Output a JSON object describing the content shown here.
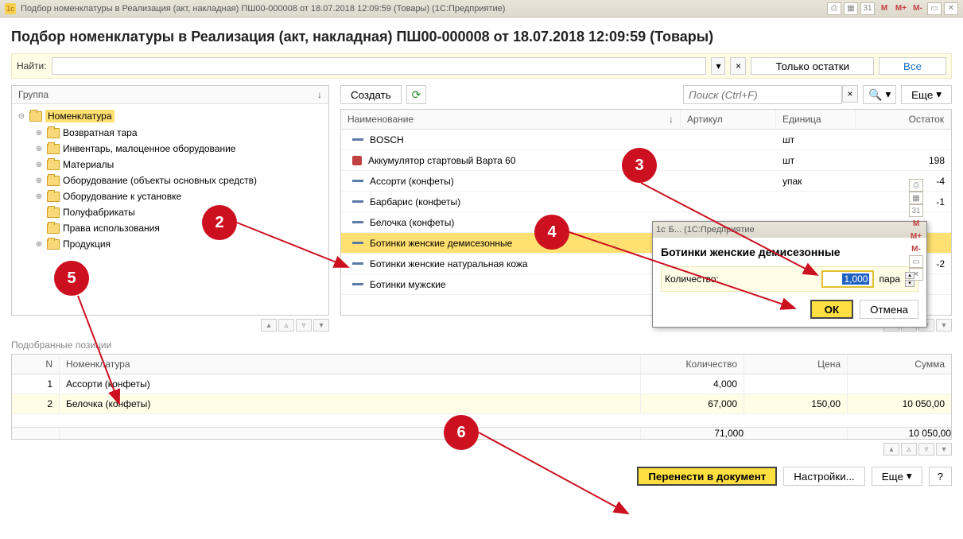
{
  "titlebar": {
    "title": "Подбор номенклатуры в Реализация (акт, накладная) ПШ00-000008 от 18.07.2018 12:09:59 (Товары)   (1С:Предприятие)"
  },
  "page_title": "Подбор номенклатуры в Реализация (акт, накладная) ПШ00-000008 от 18.07.2018 12:09:59 (Товары)",
  "find": {
    "label": "Найти:",
    "only_stock": "Только остатки",
    "all": "Все"
  },
  "group": {
    "header": "Группа",
    "items": [
      {
        "label": "Номенклатура",
        "level": 0,
        "exp": "⊖",
        "sel": true
      },
      {
        "label": "Возвратная тара",
        "level": 1,
        "exp": "⊕"
      },
      {
        "label": "Инвентарь, малоценное оборудование",
        "level": 1,
        "exp": "⊕"
      },
      {
        "label": "Материалы",
        "level": 1,
        "exp": "⊕"
      },
      {
        "label": "Оборудование (объекты основных средств)",
        "level": 1,
        "exp": "⊕"
      },
      {
        "label": "Оборудование к установке",
        "level": 1,
        "exp": "⊕"
      },
      {
        "label": "Полуфабрикаты",
        "level": 1,
        "exp": ""
      },
      {
        "label": "Права использования",
        "level": 1,
        "exp": ""
      },
      {
        "label": "Продукция",
        "level": 1,
        "exp": "⊕"
      }
    ]
  },
  "right": {
    "create": "Создать",
    "search_ph": "Поиск (Ctrl+F)",
    "more": "Еще",
    "cols": {
      "name": "Наименование",
      "art": "Артикул",
      "unit": "Единица",
      "stock": "Остаток"
    },
    "rows": [
      {
        "name": "BOSCH",
        "unit": "шт",
        "stock": "",
        "ic": "b"
      },
      {
        "name": "Аккумулятор стартовый Варта 60",
        "unit": "шт",
        "stock": "198",
        "ic": "r"
      },
      {
        "name": "Ассорти (конфеты)",
        "unit": "упак",
        "stock": "-4",
        "ic": "b"
      },
      {
        "name": "Барбарис (конфеты)",
        "unit": "",
        "stock": "-1",
        "ic": "b"
      },
      {
        "name": "Белочка (конфеты)",
        "unit": "",
        "stock": "",
        "ic": "b"
      },
      {
        "name": "Ботинки женские демисезонные",
        "unit": "",
        "stock": "",
        "sel": true,
        "ic": "b"
      },
      {
        "name": "Ботинки женские натуральная кожа",
        "unit": "",
        "stock": "-2",
        "ic": "b"
      },
      {
        "name": "Ботинки мужские",
        "unit": "",
        "stock": "",
        "ic": "b"
      }
    ]
  },
  "selected": {
    "title": "Подобранные позиции",
    "cols": {
      "n": "N",
      "name": "Номенклатура",
      "qty": "Количество",
      "price": "Цена",
      "sum": "Сумма"
    },
    "rows": [
      {
        "n": "1",
        "name": "Ассорти (конфеты)",
        "qty": "4,000",
        "price": "",
        "sum": ""
      },
      {
        "n": "2",
        "name": "Белочка (конфеты)",
        "qty": "67,000",
        "price": "150,00",
        "sum": "10 050,00",
        "hl": true
      }
    ],
    "totals": {
      "qty": "71,000",
      "sum": "10 050,00"
    }
  },
  "bottom": {
    "transfer": "Перенести в документ",
    "settings": "Настройки...",
    "more": "Еще",
    "help": "?"
  },
  "popup": {
    "title_prefix": "Б...  (1С:Предприятие",
    "name": "Ботинки женские демисезонные",
    "qty_label": "Количество:",
    "qty_value": "1,000",
    "unit": "пара",
    "ok": "ОК",
    "cancel": "Отмена"
  },
  "badges": {
    "b2": "2",
    "b3": "3",
    "b4": "4",
    "b5": "5",
    "b6": "6"
  }
}
